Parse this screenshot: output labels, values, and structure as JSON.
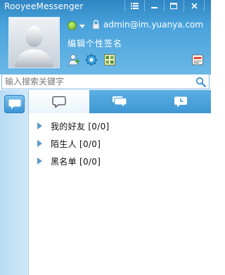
{
  "window": {
    "title": "RooyeeMessenger",
    "controls": [
      "menu",
      "skin",
      "minimize",
      "close"
    ]
  },
  "profile": {
    "account": "admin@im.yuanya.com",
    "signature": "编辑个性签名",
    "status": "online"
  },
  "search": {
    "placeholder": "输入搜索关键字"
  },
  "tabs": [
    {
      "icon": "chat-bubble-icon",
      "active": true
    },
    {
      "icon": "group-chat-icon",
      "active": false
    },
    {
      "icon": "recent-clock-icon",
      "active": false
    }
  ],
  "groups": [
    {
      "label": "我的好友 [0/0]"
    },
    {
      "label": "陌生人 [0/0]"
    },
    {
      "label": "黑名单 [0/0]"
    }
  ],
  "colors": {
    "header_top": "#2f86c3",
    "header_bottom": "#6bb8e6",
    "rail": "#c4e2f6",
    "accent": "#3f97d3"
  }
}
